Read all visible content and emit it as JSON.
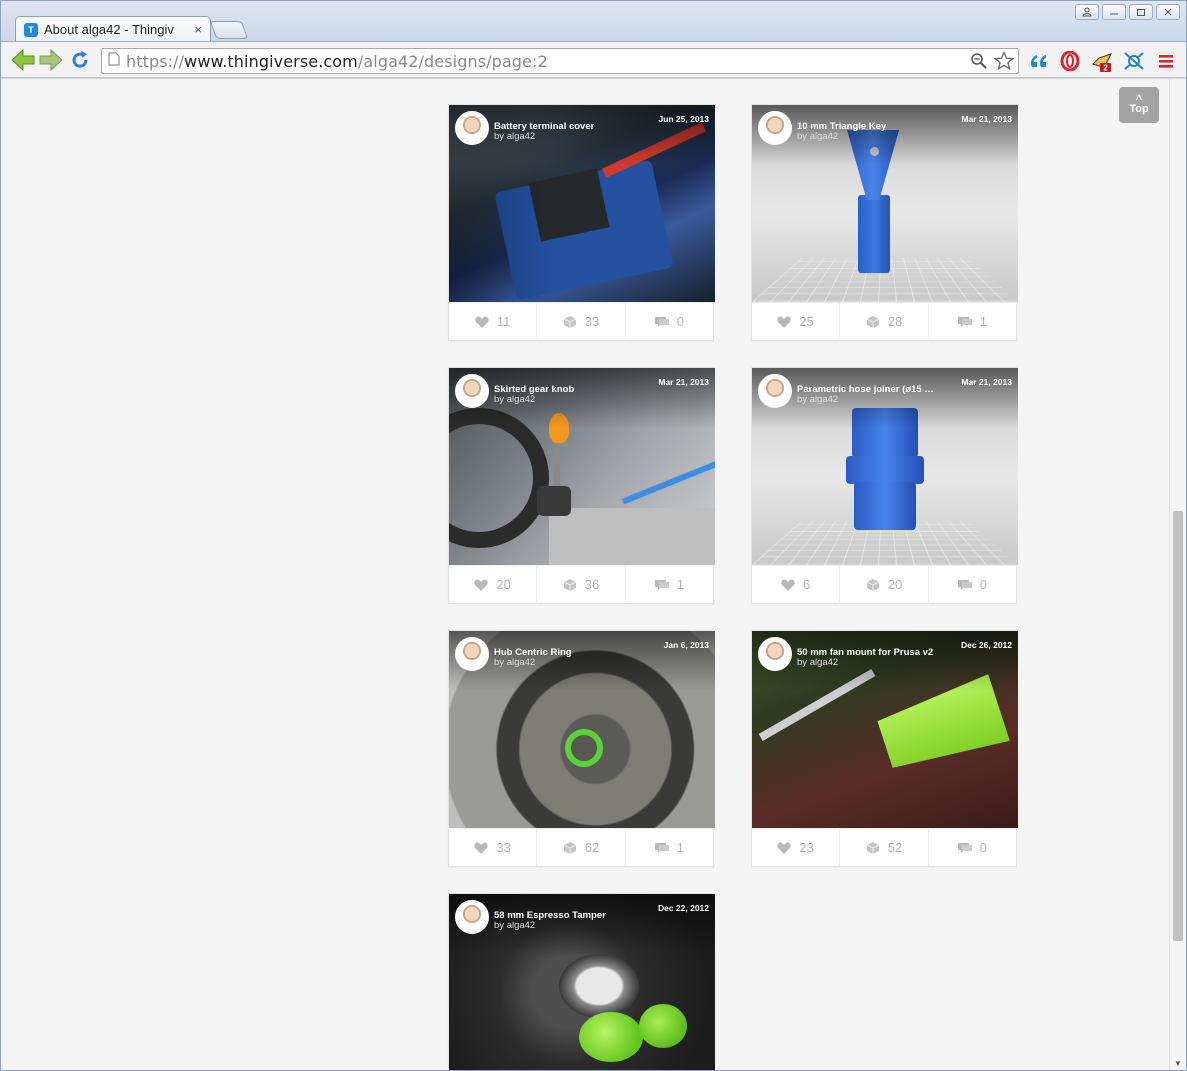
{
  "browser": {
    "tab_title": "About alga42 - Thingiv",
    "tab_close": "×",
    "favicon": "T",
    "url_scheme": "https://",
    "url_host": "www.thingiverse.com",
    "url_path": "/alga42/designs/page:2",
    "ext_badge": "2"
  },
  "page": {
    "top_button_arrow": "˄",
    "top_button_label": "Top",
    "by_prefix": "by"
  },
  "cards": [
    {
      "title": "Battery terminal cover",
      "author": "alga42",
      "date": "Jun 25, 2013",
      "likes": "11",
      "collects": "33",
      "comments": "0"
    },
    {
      "title": "10 mm Triangle Key",
      "author": "alga42",
      "date": "Mar 21, 2013",
      "likes": "25",
      "collects": "28",
      "comments": "1"
    },
    {
      "title": "Skirted gear knob",
      "author": "alga42",
      "date": "Mar 21, 2013",
      "likes": "20",
      "collects": "36",
      "comments": "1"
    },
    {
      "title": "Parametric hose joiner (ø15 …",
      "author": "alga42",
      "date": "Mar 21, 2013",
      "likes": "6",
      "collects": "20",
      "comments": "0"
    },
    {
      "title": "Hub Centric Ring",
      "author": "alga42",
      "date": "Jan 6, 2013",
      "likes": "33",
      "collects": "62",
      "comments": "1"
    },
    {
      "title": "50 mm fan mount for Prusa v2",
      "author": "alga42",
      "date": "Dec 26, 2012",
      "likes": "23",
      "collects": "52",
      "comments": "0"
    },
    {
      "title": "58 mm Espresso Tamper",
      "author": "alga42",
      "date": "Dec 22, 2012",
      "likes": "",
      "collects": "",
      "comments": ""
    }
  ]
}
